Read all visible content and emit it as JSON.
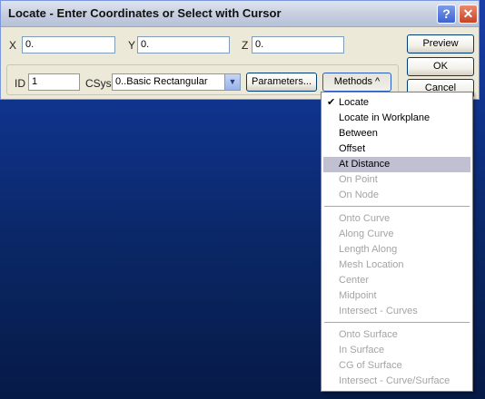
{
  "window": {
    "title": "Locate - Enter Coordinates or Select with Cursor",
    "help_label": "?",
    "close_label": "✕"
  },
  "coords": {
    "x_label": "X",
    "x_value": "0.",
    "y_label": "Y",
    "y_value": "0.",
    "z_label": "Z",
    "z_value": "0."
  },
  "row2": {
    "id_label": "ID",
    "id_value": "1",
    "csys_label": "CSys",
    "csys_value": "0..Basic Rectangular",
    "parameters_label": "Parameters...",
    "methods_label": "Methods ^"
  },
  "buttons": {
    "preview": "Preview",
    "ok": "OK",
    "cancel": "Cancel"
  },
  "menu": {
    "items": [
      {
        "label": "Locate",
        "checked": true,
        "enabled": true
      },
      {
        "label": "Locate in Workplane",
        "enabled": true
      },
      {
        "label": "Between",
        "enabled": true
      },
      {
        "label": "Offset",
        "enabled": true
      },
      {
        "label": "At Distance",
        "enabled": true,
        "highlighted": true
      },
      {
        "label": "On Point",
        "enabled": false
      },
      {
        "label": "On Node",
        "enabled": false
      },
      {
        "label": "Onto Curve",
        "enabled": false
      },
      {
        "label": "Along Curve",
        "enabled": false
      },
      {
        "label": "Length Along",
        "enabled": false
      },
      {
        "label": "Mesh Location",
        "enabled": false
      },
      {
        "label": "Center",
        "enabled": false
      },
      {
        "label": "Midpoint",
        "enabled": false
      },
      {
        "label": "Intersect - Curves",
        "enabled": false
      },
      {
        "label": "Onto Surface",
        "enabled": false
      },
      {
        "label": "In Surface",
        "enabled": false
      },
      {
        "label": "CG of Surface",
        "enabled": false
      },
      {
        "label": "Intersect - Curve/Surface",
        "enabled": false
      }
    ]
  },
  "colors": {
    "background_top": "#1a3ea8",
    "background_bottom": "#061a46",
    "menu_highlight": "#c1c0d2",
    "disabled_text": "#a4a4a4"
  }
}
